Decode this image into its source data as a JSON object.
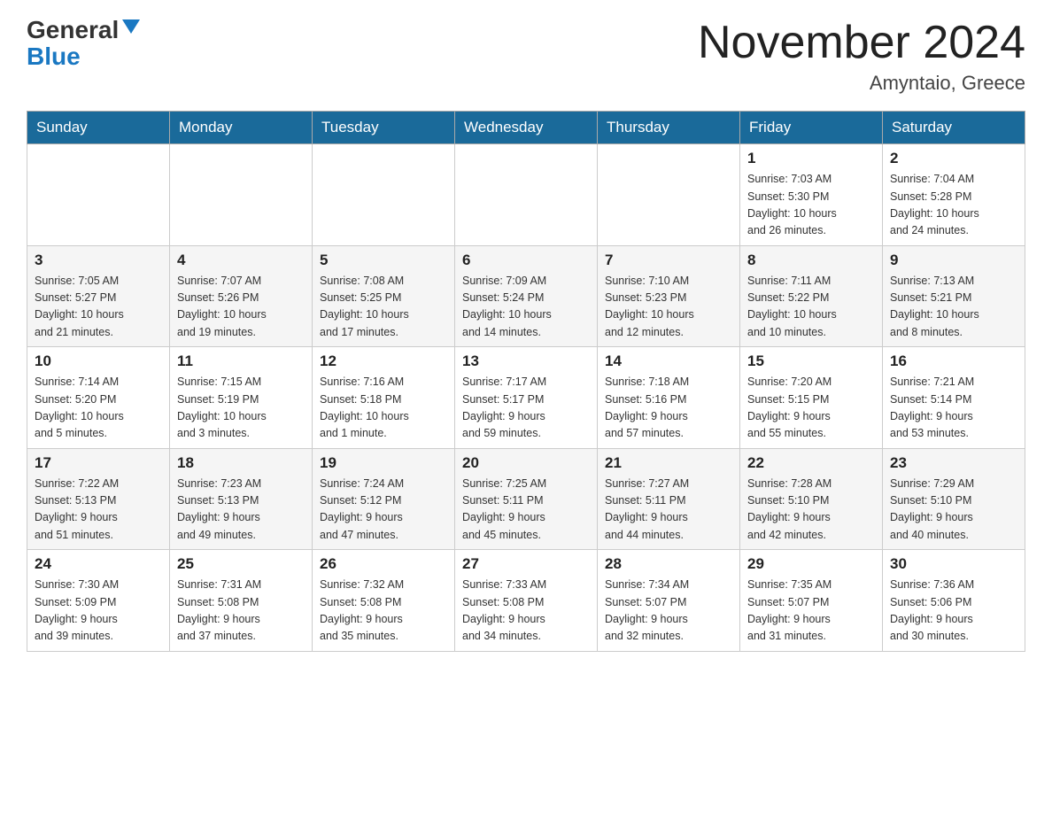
{
  "header": {
    "logo_general": "General",
    "logo_blue": "Blue",
    "month_title": "November 2024",
    "location": "Amyntaio, Greece"
  },
  "weekdays": [
    "Sunday",
    "Monday",
    "Tuesday",
    "Wednesday",
    "Thursday",
    "Friday",
    "Saturday"
  ],
  "weeks": [
    [
      {
        "day": "",
        "info": ""
      },
      {
        "day": "",
        "info": ""
      },
      {
        "day": "",
        "info": ""
      },
      {
        "day": "",
        "info": ""
      },
      {
        "day": "",
        "info": ""
      },
      {
        "day": "1",
        "info": "Sunrise: 7:03 AM\nSunset: 5:30 PM\nDaylight: 10 hours\nand 26 minutes."
      },
      {
        "day": "2",
        "info": "Sunrise: 7:04 AM\nSunset: 5:28 PM\nDaylight: 10 hours\nand 24 minutes."
      }
    ],
    [
      {
        "day": "3",
        "info": "Sunrise: 7:05 AM\nSunset: 5:27 PM\nDaylight: 10 hours\nand 21 minutes."
      },
      {
        "day": "4",
        "info": "Sunrise: 7:07 AM\nSunset: 5:26 PM\nDaylight: 10 hours\nand 19 minutes."
      },
      {
        "day": "5",
        "info": "Sunrise: 7:08 AM\nSunset: 5:25 PM\nDaylight: 10 hours\nand 17 minutes."
      },
      {
        "day": "6",
        "info": "Sunrise: 7:09 AM\nSunset: 5:24 PM\nDaylight: 10 hours\nand 14 minutes."
      },
      {
        "day": "7",
        "info": "Sunrise: 7:10 AM\nSunset: 5:23 PM\nDaylight: 10 hours\nand 12 minutes."
      },
      {
        "day": "8",
        "info": "Sunrise: 7:11 AM\nSunset: 5:22 PM\nDaylight: 10 hours\nand 10 minutes."
      },
      {
        "day": "9",
        "info": "Sunrise: 7:13 AM\nSunset: 5:21 PM\nDaylight: 10 hours\nand 8 minutes."
      }
    ],
    [
      {
        "day": "10",
        "info": "Sunrise: 7:14 AM\nSunset: 5:20 PM\nDaylight: 10 hours\nand 5 minutes."
      },
      {
        "day": "11",
        "info": "Sunrise: 7:15 AM\nSunset: 5:19 PM\nDaylight: 10 hours\nand 3 minutes."
      },
      {
        "day": "12",
        "info": "Sunrise: 7:16 AM\nSunset: 5:18 PM\nDaylight: 10 hours\nand 1 minute."
      },
      {
        "day": "13",
        "info": "Sunrise: 7:17 AM\nSunset: 5:17 PM\nDaylight: 9 hours\nand 59 minutes."
      },
      {
        "day": "14",
        "info": "Sunrise: 7:18 AM\nSunset: 5:16 PM\nDaylight: 9 hours\nand 57 minutes."
      },
      {
        "day": "15",
        "info": "Sunrise: 7:20 AM\nSunset: 5:15 PM\nDaylight: 9 hours\nand 55 minutes."
      },
      {
        "day": "16",
        "info": "Sunrise: 7:21 AM\nSunset: 5:14 PM\nDaylight: 9 hours\nand 53 minutes."
      }
    ],
    [
      {
        "day": "17",
        "info": "Sunrise: 7:22 AM\nSunset: 5:13 PM\nDaylight: 9 hours\nand 51 minutes."
      },
      {
        "day": "18",
        "info": "Sunrise: 7:23 AM\nSunset: 5:13 PM\nDaylight: 9 hours\nand 49 minutes."
      },
      {
        "day": "19",
        "info": "Sunrise: 7:24 AM\nSunset: 5:12 PM\nDaylight: 9 hours\nand 47 minutes."
      },
      {
        "day": "20",
        "info": "Sunrise: 7:25 AM\nSunset: 5:11 PM\nDaylight: 9 hours\nand 45 minutes."
      },
      {
        "day": "21",
        "info": "Sunrise: 7:27 AM\nSunset: 5:11 PM\nDaylight: 9 hours\nand 44 minutes."
      },
      {
        "day": "22",
        "info": "Sunrise: 7:28 AM\nSunset: 5:10 PM\nDaylight: 9 hours\nand 42 minutes."
      },
      {
        "day": "23",
        "info": "Sunrise: 7:29 AM\nSunset: 5:10 PM\nDaylight: 9 hours\nand 40 minutes."
      }
    ],
    [
      {
        "day": "24",
        "info": "Sunrise: 7:30 AM\nSunset: 5:09 PM\nDaylight: 9 hours\nand 39 minutes."
      },
      {
        "day": "25",
        "info": "Sunrise: 7:31 AM\nSunset: 5:08 PM\nDaylight: 9 hours\nand 37 minutes."
      },
      {
        "day": "26",
        "info": "Sunrise: 7:32 AM\nSunset: 5:08 PM\nDaylight: 9 hours\nand 35 minutes."
      },
      {
        "day": "27",
        "info": "Sunrise: 7:33 AM\nSunset: 5:08 PM\nDaylight: 9 hours\nand 34 minutes."
      },
      {
        "day": "28",
        "info": "Sunrise: 7:34 AM\nSunset: 5:07 PM\nDaylight: 9 hours\nand 32 minutes."
      },
      {
        "day": "29",
        "info": "Sunrise: 7:35 AM\nSunset: 5:07 PM\nDaylight: 9 hours\nand 31 minutes."
      },
      {
        "day": "30",
        "info": "Sunrise: 7:36 AM\nSunset: 5:06 PM\nDaylight: 9 hours\nand 30 minutes."
      }
    ]
  ]
}
